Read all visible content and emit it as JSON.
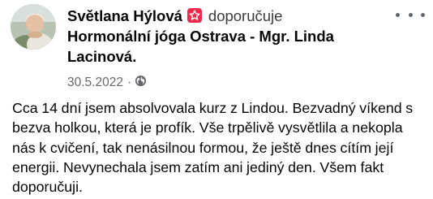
{
  "post": {
    "author": "Světlana Hýlová",
    "action": "doporučuje",
    "page": "Hormonální jóga Ostrava - Mgr. Linda Lacinová.",
    "date": "30.5.2022",
    "separator": "·",
    "privacy_icon": "globe-icon",
    "badge_icon": "recommend-star-icon",
    "badge_color": "#f02849",
    "menu_icon": "more-options-icon",
    "text": "Cca 14 dní jsem absolvovala kurz z Lindou. Bezvadný víkend s bezva holkou, která je profík. Vše trpělivě vysvětlila a nekopla nás k cvičení, tak nenásilnou formou, že ještě dnes cítím její energii. Nevynechala jsem zatím ani jediný den. Všem fakt doporučuji."
  }
}
